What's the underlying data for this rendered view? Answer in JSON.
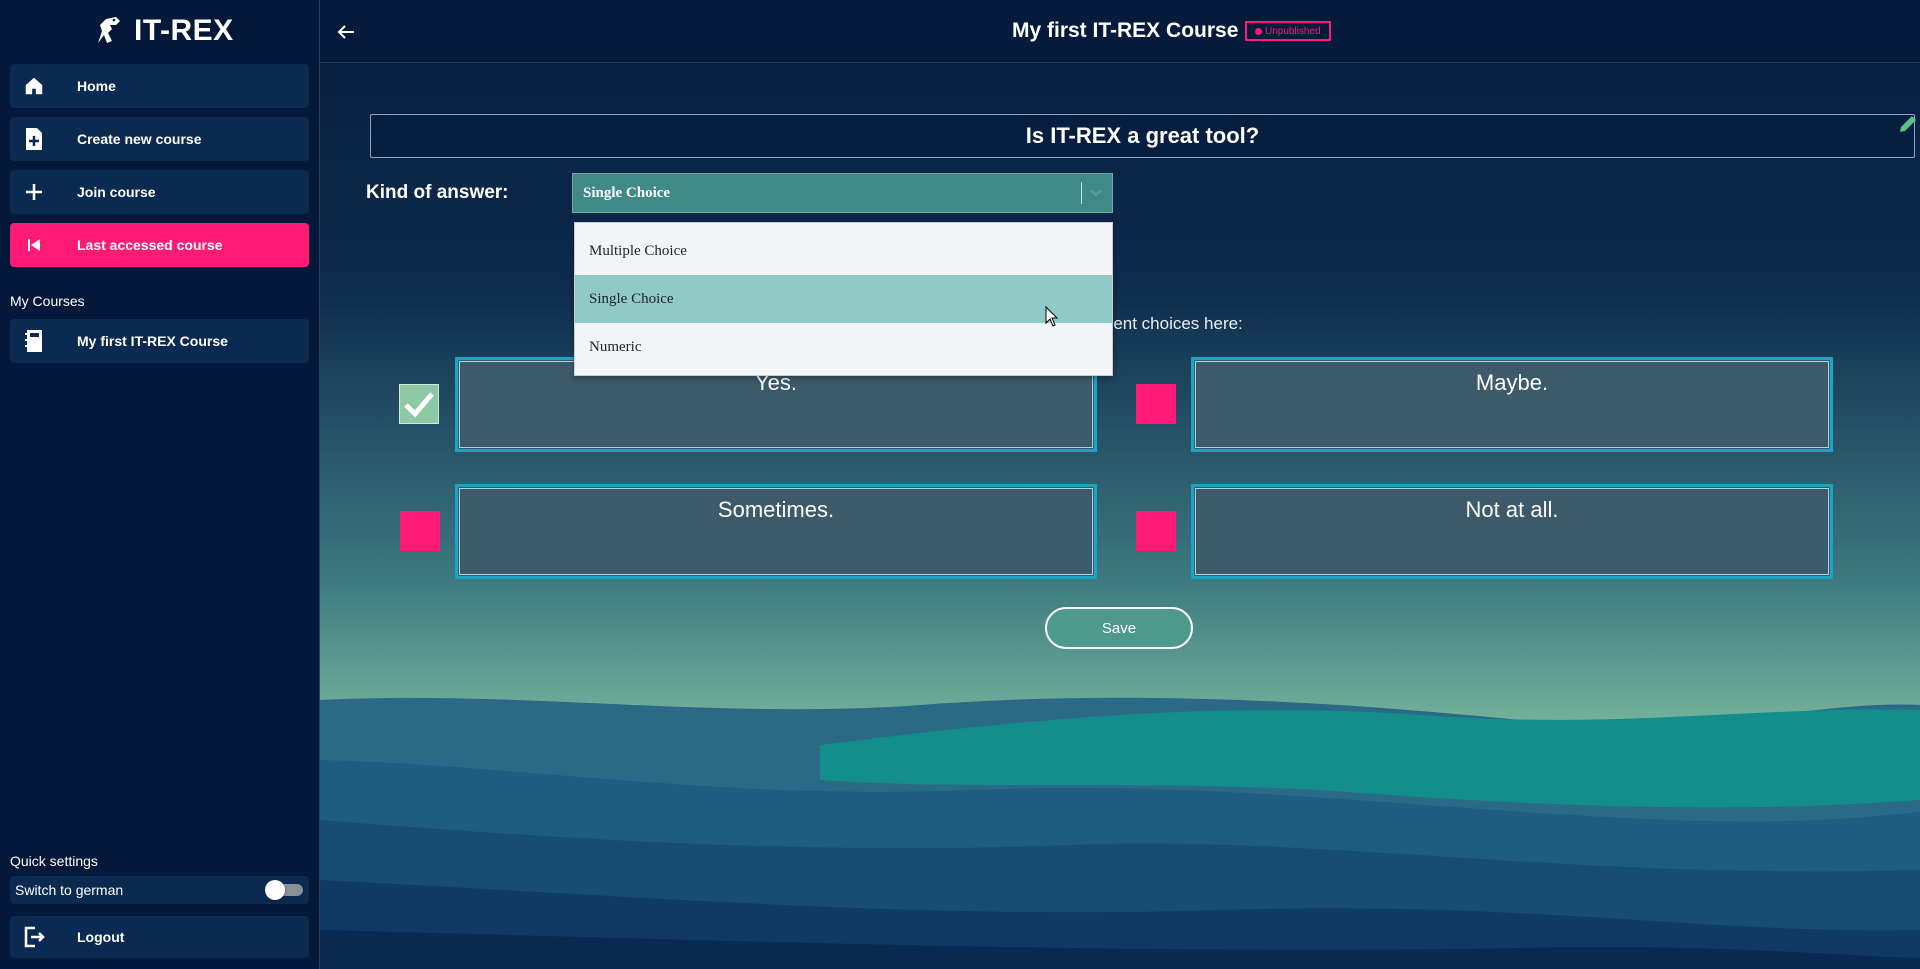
{
  "app": {
    "name": "IT-REX"
  },
  "sidebar": {
    "nav": [
      {
        "label": "Home",
        "icon": "home-icon"
      },
      {
        "label": "Create new course",
        "icon": "file-plus-icon"
      },
      {
        "label": "Join course",
        "icon": "plus-icon"
      },
      {
        "label": "Last accessed course",
        "icon": "skip-back-icon"
      }
    ],
    "my_courses_label": "My Courses",
    "courses": [
      {
        "label": "My first IT-REX Course",
        "icon": "notebook-icon"
      }
    ],
    "quick_settings_label": "Quick settings",
    "switch_german_label": "Switch to german",
    "switch_german_on": false,
    "logout_label": "Logout"
  },
  "header": {
    "course_title": "My first IT-REX Course",
    "status_badge": "Unpublished"
  },
  "question": {
    "title": "Is IT-REX a great tool?"
  },
  "answer_kind": {
    "label": "Kind of answer:",
    "selected": "Single Choice",
    "options": [
      "Multiple Choice",
      "Single Choice",
      "Numeric"
    ]
  },
  "choices": {
    "label": "Specify the different choices here:",
    "items": [
      {
        "text": "Yes.",
        "correct": true
      },
      {
        "text": "Maybe.",
        "correct": false
      },
      {
        "text": "Sometimes.",
        "correct": false
      },
      {
        "text": "Not at all.",
        "correct": false
      }
    ]
  },
  "save_label": "Save",
  "colors": {
    "accent": "#ff1a75",
    "teal": "#3f8a87",
    "sidebar": "#04183a"
  }
}
